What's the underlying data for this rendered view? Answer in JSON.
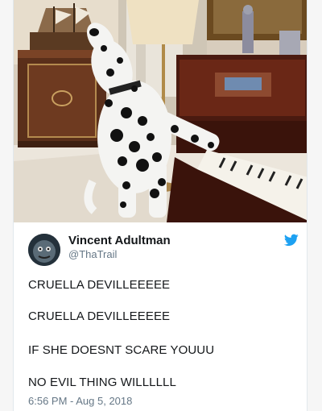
{
  "tweet": {
    "author_name": "Vincent Adultman",
    "author_handle": "@ThaTrail",
    "lines": [
      "CRUELLA DEVILLEEEEE",
      "CRUELLA DEVILLEEEEE",
      "IF SHE DOESNT SCARE YOUUU",
      "NO EVIL THING WILLLLLL"
    ],
    "timestamp": "6:56 PM - Aug 5, 2018"
  },
  "icons": {
    "brand": "twitter-bird-icon",
    "avatar": "avatar-face"
  },
  "colors": {
    "brand_blue": "#1da1f2",
    "text": "#14171a",
    "muted": "#657786"
  },
  "media": {
    "description_icon": "dalmatian-playing-piano-photo"
  }
}
